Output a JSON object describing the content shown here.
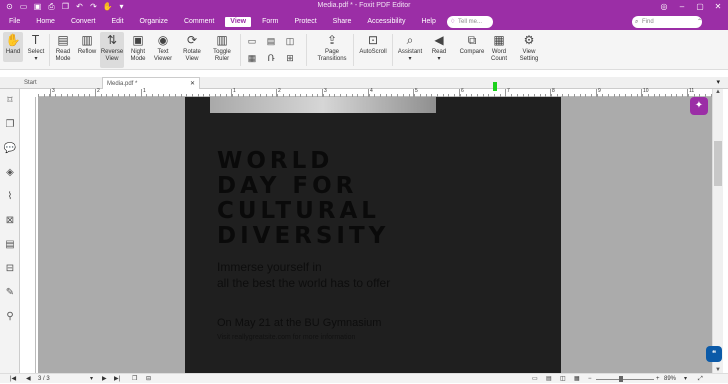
{
  "app": {
    "window_title": "Media.pdf * - Foxit PDF Editor"
  },
  "quick_access": {
    "icons": [
      "app-menu-icon",
      "open-icon",
      "save-icon",
      "print-icon",
      "copy-icon",
      "undo-icon",
      "redo-icon",
      "hand-tool-icon",
      "dropdown-icon"
    ]
  },
  "menu": {
    "items": [
      "File",
      "Home",
      "Convert",
      "Edit",
      "Organize",
      "Comment",
      "View",
      "Form",
      "Protect",
      "Share",
      "Accessibility",
      "Help"
    ],
    "active": "View"
  },
  "tell_me": {
    "placeholder": "Tell me..."
  },
  "find": {
    "placeholder": "Find"
  },
  "ribbon": {
    "hand": "Hand",
    "select": "Select",
    "read_mode": "Read Mode",
    "reflow": "Reflow",
    "reverse_view": "Reverse View",
    "night_mode": "Night Mode",
    "text_viewer": "Text Viewer",
    "rotate_view": "Rotate View",
    "toggle_ruler": "Toggle Ruler",
    "page_transitions": "Page Transitions",
    "autoscroll": "AutoScroll",
    "assistant": "Assistant",
    "read": "Read",
    "compare": "Compare",
    "word_count": "Word Count",
    "view_setting": "View Setting"
  },
  "tabs": {
    "start": "Start",
    "media": "Media.pdf *"
  },
  "ruler": {
    "labels": [
      "3",
      "2",
      "1",
      "1",
      "2",
      "3",
      "4",
      "5",
      "6",
      "7",
      "8",
      "9",
      "10",
      "11"
    ]
  },
  "document": {
    "headline": [
      "WORLD",
      "DAY FOR",
      "CULTURAL",
      "DIVERSITY"
    ],
    "subtitle": [
      "Immerse yourself in",
      "all the best the world has to offer"
    ],
    "event": "On May 21 at the BU Gymnasium",
    "visit": "Visit reallygreatsite.com for more information"
  },
  "statusbar": {
    "page": "3 / 3",
    "zoom": "89%"
  },
  "colors": {
    "accent": "#9b2ea6",
    "page_background": "#1f1f1f",
    "workspace": "#ababab"
  }
}
